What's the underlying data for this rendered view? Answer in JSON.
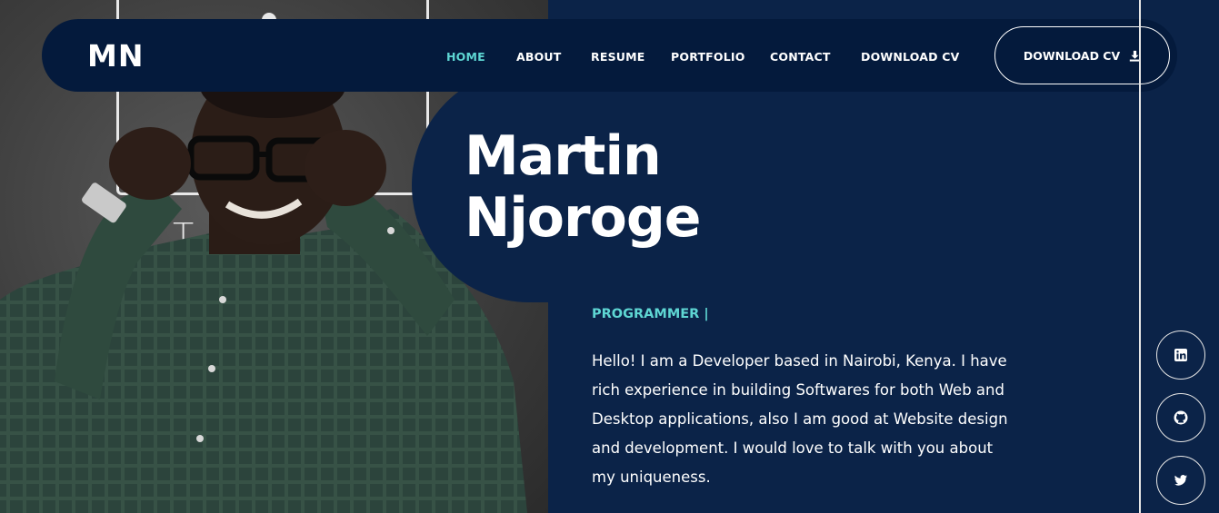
{
  "header": {
    "logo": "MN",
    "nav": [
      {
        "label": "HOME",
        "active": true
      },
      {
        "label": "ABOUT",
        "active": false
      },
      {
        "label": "RESUME",
        "active": false
      },
      {
        "label": "PORTFOLIO",
        "active": false
      },
      {
        "label": "CONTACT",
        "active": false
      },
      {
        "label": "DOWNLOAD CV",
        "active": false
      }
    ],
    "cv_button": {
      "label": "DOWNLOAD CV",
      "icon": "download-icon"
    }
  },
  "hero": {
    "first_name": "Martin",
    "last_name": "Njoroge",
    "role": "PROGRAMMER |",
    "bio": "Hello! I am a Developer based in Nairobi, Kenya. I have rich experience in building Softwares for both Web and Desktop applications, also I am good at Website design and development. I would love to talk with you about my uniqueness.",
    "photo_board_text": "TE     Y"
  },
  "social": [
    {
      "icon": "linkedin-icon"
    },
    {
      "icon": "github-icon"
    },
    {
      "icon": "twitter-icon"
    }
  ],
  "colors": {
    "background": "#0b2348",
    "nav_background": "#041a3c",
    "accent": "#5ed6d3",
    "text": "#ffffff"
  }
}
